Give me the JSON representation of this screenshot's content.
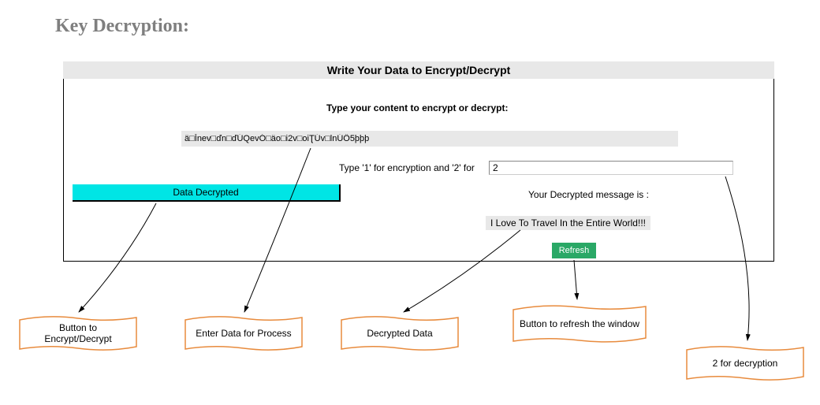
{
  "heading": "Key Decryption:",
  "bannerTitle": "Write Your Data to Encrypt/Decrypt",
  "prompt": "Type your content to encrypt or decrypt:",
  "dataValue": "ä□Ĭnev□ďn□ďÚQevÓ□äo□i2v□oiƮÚv□lnÚÔ5þþþ",
  "modeLabel": "Type '1' for encryption and '2' for",
  "modeValue": "2",
  "decryptBtn": "Data Decrypted",
  "resultLabel": "Your Decrypted message is :",
  "resultValue": "I Love To Travel In the Entire World!!!",
  "refreshBtn": "Refresh",
  "callouts": {
    "c1": "Button to Encrypt/Decrypt",
    "c2": "Enter Data for Process",
    "c3": "Decrypted Data",
    "c4": "Button to refresh the window",
    "c5": "2 for decryption"
  },
  "colors": {
    "orange": "#e88b3d",
    "cyan": "#00e5e5",
    "green": "#2aa866",
    "headingGray": "#7f7f7f",
    "fieldGray": "#e8e8e8"
  }
}
